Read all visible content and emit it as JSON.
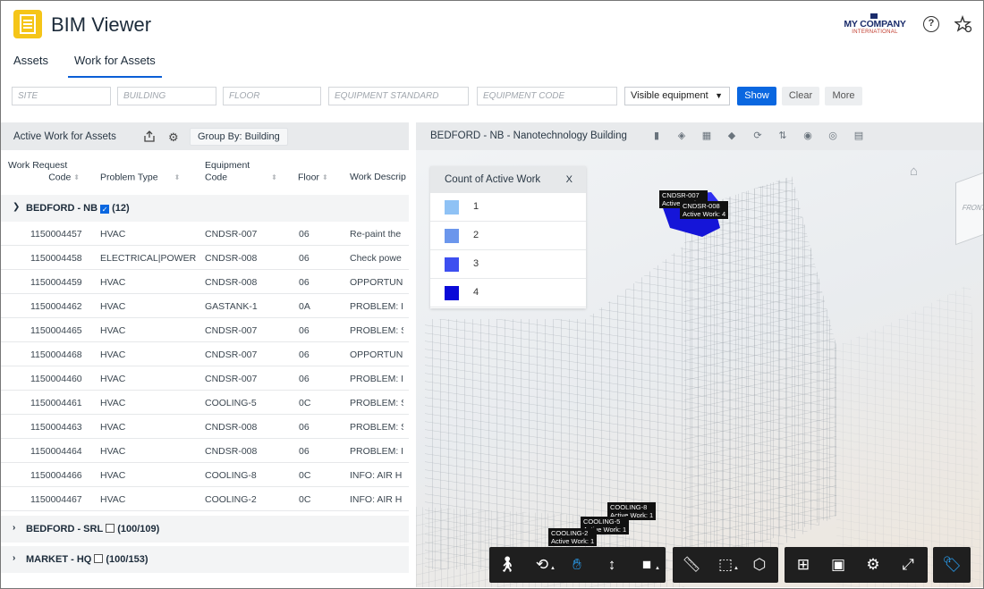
{
  "app": {
    "title": "BIM Viewer",
    "brand_main": "MY COMPANY",
    "brand_sub": "INTERNATIONAL",
    "help_symbol": "?"
  },
  "tabs": [
    {
      "label": "Assets"
    },
    {
      "label": "Work for Assets",
      "active": true
    }
  ],
  "filters": {
    "inputs": [
      {
        "placeholder": "SITE"
      },
      {
        "placeholder": "BUILDING"
      },
      {
        "placeholder": "FLOOR"
      },
      {
        "placeholder": "EQUIPMENT STANDARD"
      },
      {
        "placeholder": "EQUIPMENT CODE"
      }
    ],
    "select_value": "Visible equipment",
    "show_label": "Show",
    "clear_label": "Clear",
    "more_label": "More"
  },
  "left_panel": {
    "title": "Active Work for Assets",
    "group_by_label": "Group By: Building",
    "columns": {
      "c1a": "Work Request",
      "c1b": "Code",
      "c2": "Problem Type",
      "c3a": "Equipment",
      "c3b": "Code",
      "c4": "Floor",
      "c5": "Work Descrip"
    },
    "groups": [
      {
        "name": "BEDFORD - NB",
        "count": "(12)",
        "checked": true
      },
      {
        "name": "BEDFORD - SRL",
        "count": "(100/109)",
        "checked": false
      },
      {
        "name": "MARKET - HQ",
        "count": "(100/153)",
        "checked": false
      }
    ],
    "rows": [
      [
        "1150004457",
        "HVAC",
        "CNDSR-007",
        "06",
        "Re-paint the"
      ],
      [
        "1150004458",
        "ELECTRICAL|POWER",
        "CNDSR-008",
        "06",
        "Check powe"
      ],
      [
        "1150004459",
        "HVAC",
        "CNDSR-008",
        "06",
        "OPPORTUNI"
      ],
      [
        "1150004462",
        "HVAC",
        "GASTANK-1",
        "0A",
        "PROBLEM: I"
      ],
      [
        "1150004465",
        "HVAC",
        "CNDSR-007",
        "06",
        "PROBLEM: S"
      ],
      [
        "1150004468",
        "HVAC",
        "CNDSR-007",
        "06",
        "OPPORTUNI"
      ],
      [
        "1150004460",
        "HVAC",
        "CNDSR-007",
        "06",
        "PROBLEM: I"
      ],
      [
        "1150004461",
        "HVAC",
        "COOLING-5",
        "0C",
        "PROBLEM: S"
      ],
      [
        "1150004463",
        "HVAC",
        "CNDSR-008",
        "06",
        "PROBLEM: S"
      ],
      [
        "1150004464",
        "HVAC",
        "CNDSR-008",
        "06",
        "PROBLEM: I"
      ],
      [
        "1150004466",
        "HVAC",
        "COOLING-8",
        "0C",
        "INFO: AIR H"
      ],
      [
        "1150004467",
        "HVAC",
        "COOLING-2",
        "0C",
        "INFO: AIR H"
      ]
    ]
  },
  "viewer": {
    "title": "BEDFORD - NB - Nanotechnology Building",
    "legend": {
      "title": "Count of Active Work",
      "close": "X",
      "items": [
        {
          "label": "1",
          "color": "#8fc2f5"
        },
        {
          "label": "2",
          "color": "#6b96ec"
        },
        {
          "label": "3",
          "color": "#3d4ff0"
        },
        {
          "label": "4",
          "color": "#0a0ad8"
        }
      ]
    },
    "tags": [
      {
        "name": "CNDSR-007",
        "work": "Active Work: 4"
      },
      {
        "name": "CNDSR-008",
        "work": "Active Work: 4"
      },
      {
        "name": "COOLING-8",
        "work": "Active Work: 1"
      },
      {
        "name": "COOLING-5",
        "work": "Active Work: 1"
      },
      {
        "name": "COOLING-2",
        "work": "Active Work: 1"
      }
    ],
    "cube_label": "FRONT"
  }
}
